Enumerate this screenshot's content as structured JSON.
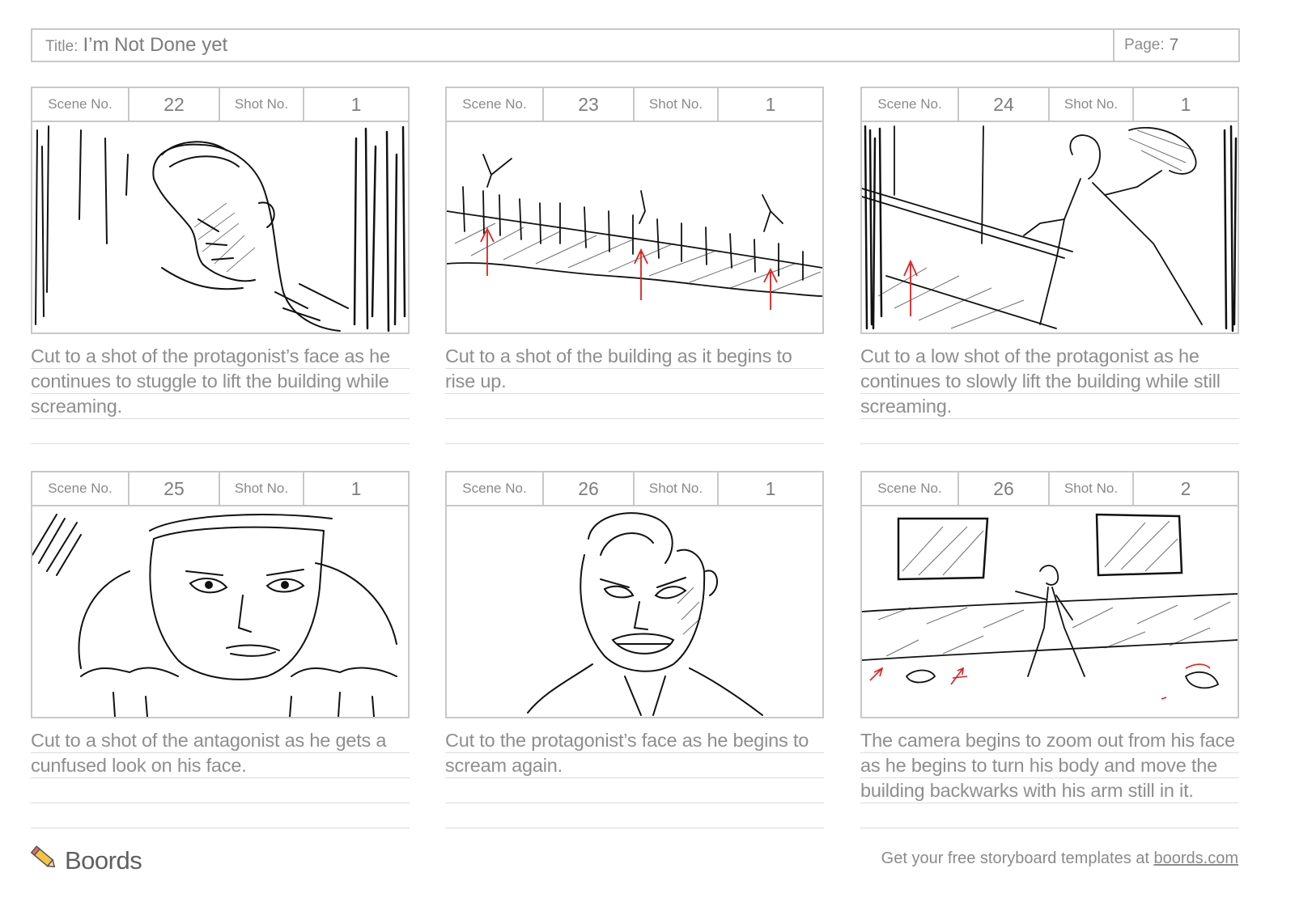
{
  "header": {
    "title_label": "Title:",
    "title_value": "I’m Not Done yet",
    "page_label": "Page:",
    "page_value": "7"
  },
  "labels": {
    "scene": "Scene No.",
    "shot": "Shot No."
  },
  "panels": [
    {
      "scene": "22",
      "shot": "1",
      "caption": "Cut to a shot of the protagonist’s face as he continues to stuggle to lift the building while screaming."
    },
    {
      "scene": "23",
      "shot": "1",
      "caption": "Cut to a shot of the building as it begins to rise up."
    },
    {
      "scene": "24",
      "shot": "1",
      "caption": "Cut to a low shot of the protagonist as he continues to slowly lift the building while still screaming."
    },
    {
      "scene": "25",
      "shot": "1",
      "caption": "Cut to a shot of the antagonist as he gets a cunfused look on his face."
    },
    {
      "scene": "26",
      "shot": "1",
      "caption": "Cut to the protagonist’s face as he begins to scream again."
    },
    {
      "scene": "26",
      "shot": "2",
      "caption": "The camera begins to zoom out from his face as he begins to turn his body and move the building backwarks with his arm still in it."
    }
  ],
  "footer": {
    "brand": "Boords",
    "note": "Get your free storyboard templates at",
    "link": "boords.com"
  },
  "colors": {
    "border": "#c8c8c8",
    "text": "#8a8a8a",
    "sketch_ink": "#111111",
    "arrow_red": "#e02020"
  }
}
